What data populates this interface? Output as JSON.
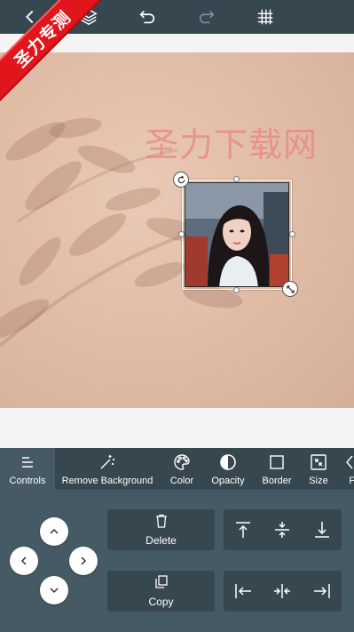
{
  "watermark": {
    "ribbon_text": "圣力专测",
    "canvas_text": "圣力下载网"
  },
  "toolbar": {
    "icons": [
      "layers-icon",
      "undo-icon",
      "redo-icon",
      "grid-icon"
    ]
  },
  "tabs": [
    {
      "label": "Controls",
      "icon": "controls-icon",
      "active": true
    },
    {
      "label": "Remove Background",
      "icon": "magic-wand-icon",
      "active": false
    },
    {
      "label": "Color",
      "icon": "palette-icon",
      "active": false
    },
    {
      "label": "Opacity",
      "icon": "opacity-icon",
      "active": false
    },
    {
      "label": "Border",
      "icon": "border-icon",
      "active": false
    },
    {
      "label": "Size",
      "icon": "size-icon",
      "active": false
    },
    {
      "label": "Fl",
      "icon": "flip-icon",
      "active": false
    }
  ],
  "controls": {
    "delete_label": "Delete",
    "copy_label": "Copy"
  },
  "colors": {
    "toolbar_bg": "#37474f",
    "panel_bg": "#455a64",
    "ribbon_red": "#e0161c",
    "canvas_bg": "#dfbba6"
  }
}
